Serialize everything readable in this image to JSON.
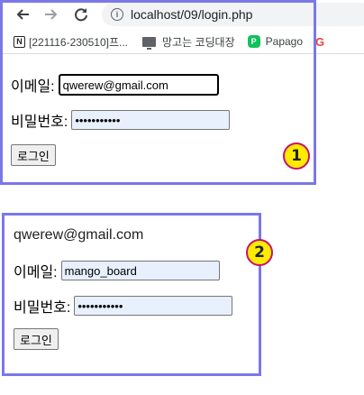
{
  "browser": {
    "url": "localhost/09/login.php",
    "bookmarks": [
      {
        "label": "[221116-230510]프...",
        "icon": "notion-icon"
      },
      {
        "label": "망고는 코딩대장",
        "icon": "monitor-icon"
      },
      {
        "label": "Papago",
        "icon": "papago-icon"
      },
      {
        "label": "G",
        "icon": "google-icon"
      }
    ]
  },
  "form1": {
    "email_label": "이메일:",
    "email_value": "qwerew@gmail.com",
    "password_label": "비밀번호:",
    "password_value": "•••••••••••",
    "login_button": "로그인",
    "badge": "1"
  },
  "form2": {
    "welcome_text": "qwerew@gmail.com",
    "email_label": "이메일:",
    "email_value": "mango_board",
    "password_label": "비밀번호:",
    "password_value": "•••••••••••",
    "login_button": "로그인",
    "badge": "2"
  },
  "colors": {
    "frame_border": "#7b78e8",
    "badge_fill": "#ffeb00",
    "badge_border": "#c8106e",
    "autofill_bg": "#e8f0fe"
  }
}
